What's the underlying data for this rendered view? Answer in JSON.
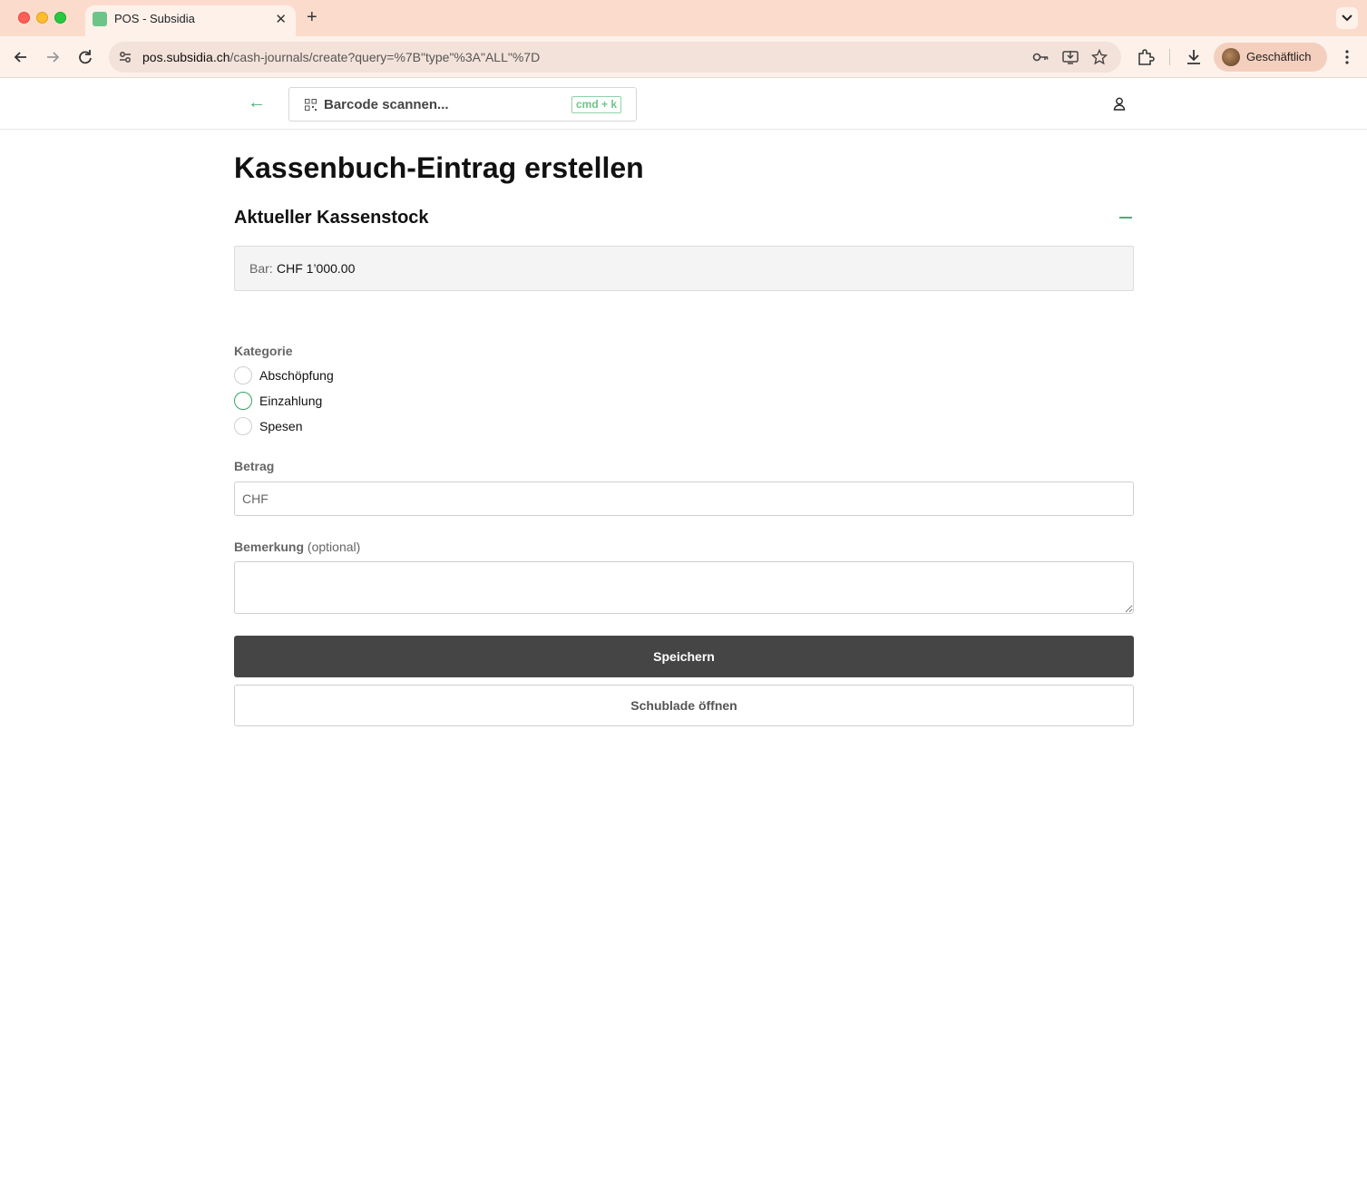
{
  "browser": {
    "tab_title": "POS - Subsidia",
    "url_host": "pos.subsidia.ch",
    "url_path": "/cash-journals/create?query=%7B\"type\"%3A\"ALL\"%7D",
    "profile_label": "Geschäftlich",
    "icons": [
      "back-icon",
      "forward-icon",
      "reload-icon",
      "site-settings-icon",
      "password-key-icon",
      "install-app-icon",
      "bookmark-star-icon",
      "extensions-icon",
      "downloads-icon",
      "menu-icon"
    ]
  },
  "header": {
    "back_glyph": "←",
    "scan_placeholder": "Barcode scannen...",
    "scan_shortcut": "cmd + k"
  },
  "page": {
    "title_bold": "Kassenbuch-Eintrag",
    "title_rest": " erstellen",
    "stock_section_title": "Aktueller Kassenstock",
    "stock_label": "Bar:",
    "stock_value": "CHF 1’000.00"
  },
  "form": {
    "category_label": "Kategorie",
    "categories": [
      {
        "label": "Abschöpfung",
        "selected": false
      },
      {
        "label": "Einzahlung",
        "selected": false
      },
      {
        "label": "Spesen",
        "selected": false
      }
    ],
    "amount_label": "Betrag",
    "amount_placeholder": "CHF",
    "remark_label": "Bemerkung",
    "remark_optional": "(optional)",
    "save_label": "Speichern",
    "drawer_label": "Schublade öffnen"
  },
  "colors": {
    "accent_green": "#4caf7a",
    "primary_button": "#454545",
    "tabbar_bg": "#fbdccc"
  }
}
